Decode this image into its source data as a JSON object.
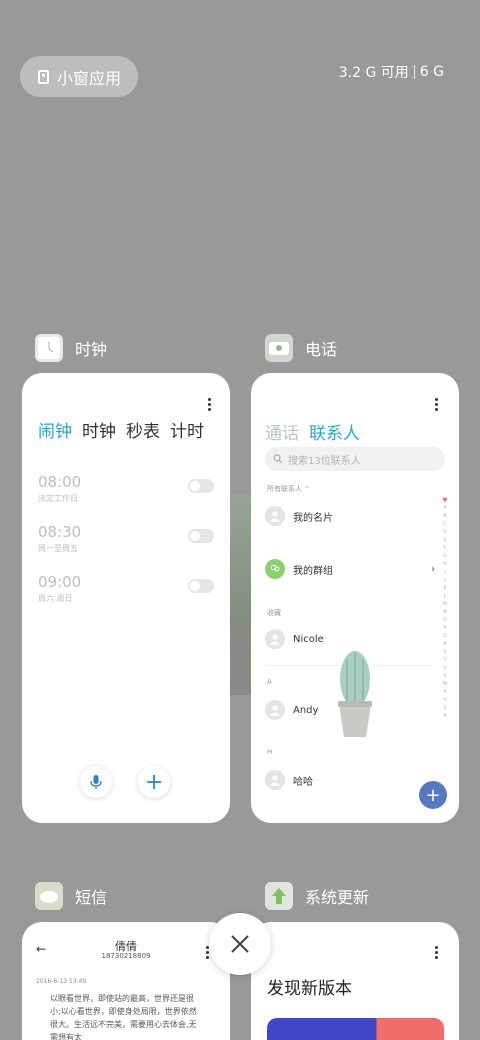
{
  "header": {
    "floating_apps_label": "小窗应用",
    "memory_available": "3.2 G 可用",
    "memory_total": "6 G"
  },
  "clock_app": {
    "name": "时钟",
    "tabs": [
      "闹钟",
      "时钟",
      "秒表",
      "计时"
    ],
    "active_tab": "闹钟",
    "alarms": [
      {
        "time": "08:00",
        "repeat": "法定工作日",
        "enabled": false
      },
      {
        "time": "08:30",
        "repeat": "周一至周五",
        "enabled": false
      },
      {
        "time": "09:00",
        "repeat": "周六 周日",
        "enabled": false
      }
    ],
    "mic_icon": "mic-icon",
    "add_icon": "plus-icon"
  },
  "phone_app": {
    "name": "电话",
    "tabs": [
      "通话",
      "联系人"
    ],
    "active_tab": "联系人",
    "search_placeholder": "搜索13位联系人",
    "all_contacts_label": "所有联系人",
    "my_card": "我的名片",
    "my_groups": "我的群组",
    "favorites_label": "收藏",
    "contacts": [
      {
        "section": "",
        "name": "Nicole"
      },
      {
        "section": "A",
        "name": "Andy"
      },
      {
        "section": "H",
        "name": "哈哈"
      }
    ],
    "index_letters": [
      "A",
      "B",
      "C",
      "D",
      "E",
      "F",
      "G",
      "H",
      "I",
      "J",
      "K",
      "L",
      "M",
      "N",
      "O",
      "P",
      "Q",
      "R",
      "S",
      "T",
      "U",
      "V",
      "W",
      "X",
      "Y",
      "Z",
      "#"
    ],
    "accent": "#2fa6c8",
    "fab_color": "#5678c0"
  },
  "sms_app": {
    "name": "短信",
    "contact_name": "倩倩",
    "contact_number": "18730218809",
    "date": "2016-6-13 13:49",
    "message": "以眼看世界，即使站的最高，世界还是很小;以心看世界，即使身处局限，世界依然很大。生活远不完美，需要用心去体会,无需想有太"
  },
  "update_app": {
    "name": "系统更新",
    "title": "发现新版本"
  },
  "close_icon": "close-icon"
}
